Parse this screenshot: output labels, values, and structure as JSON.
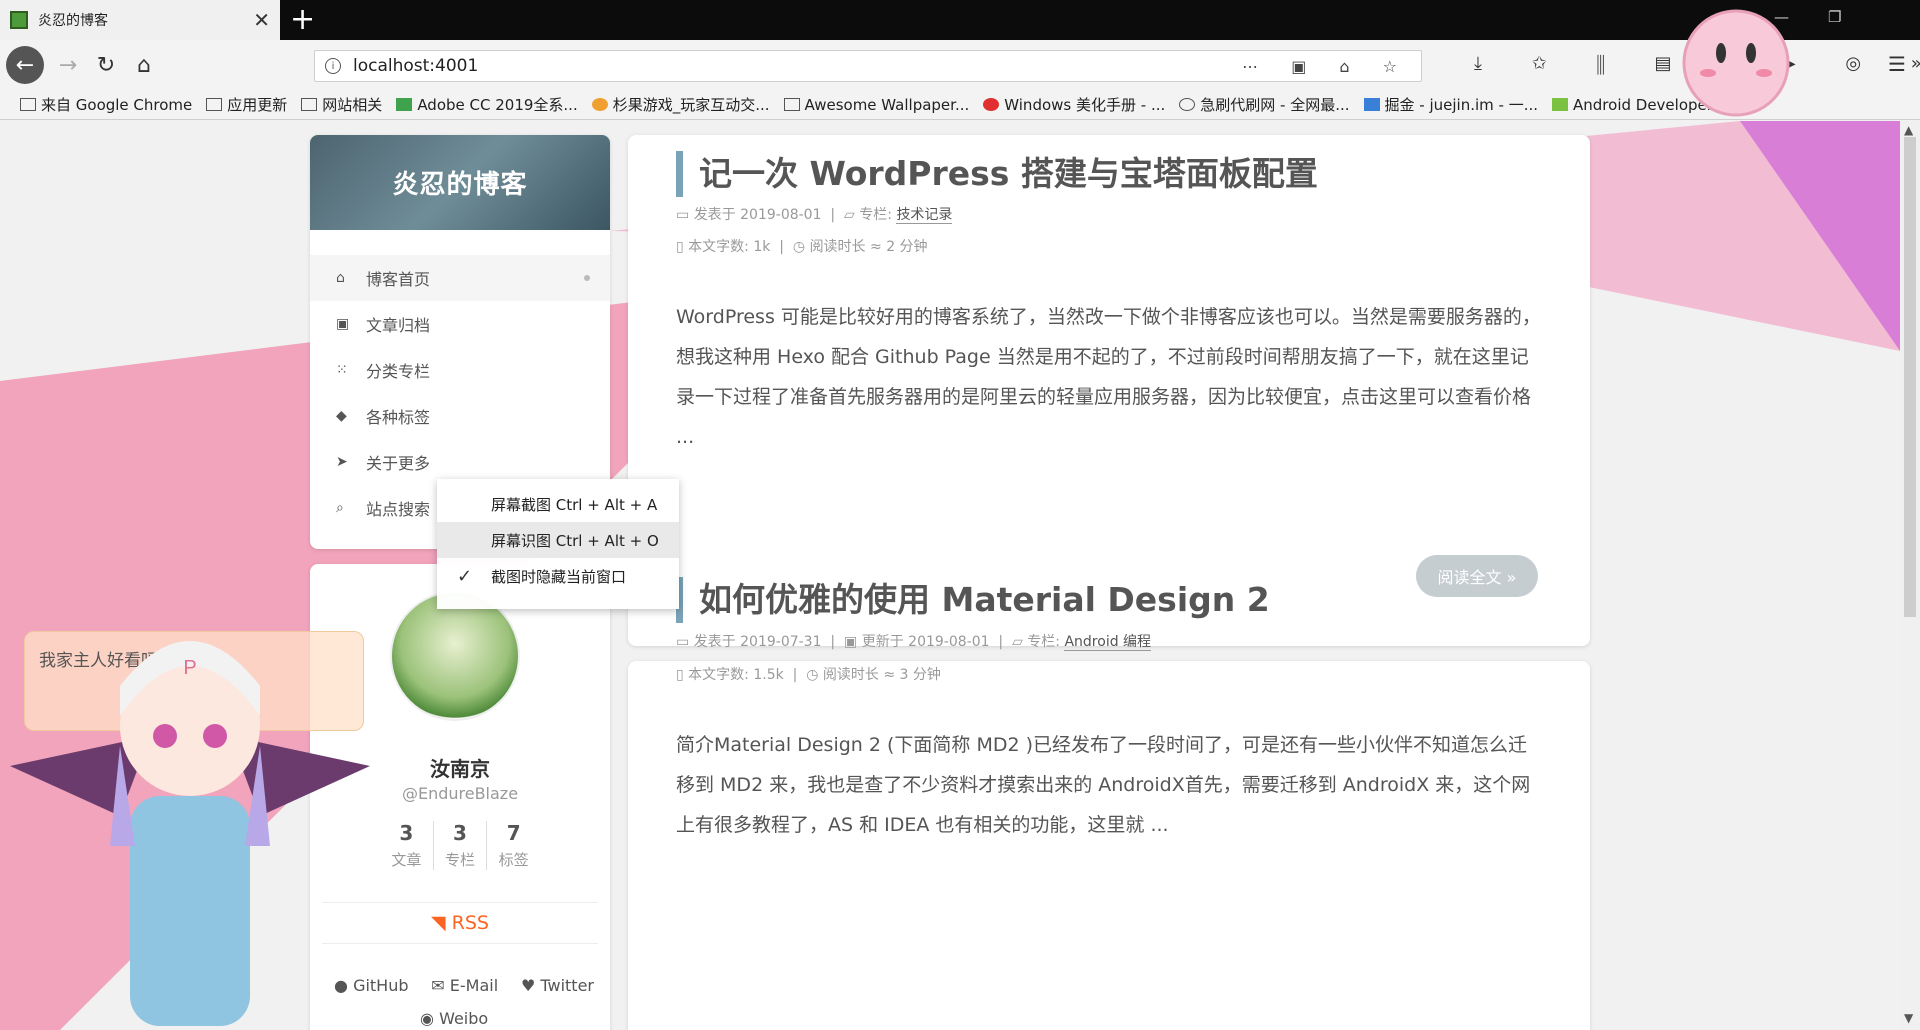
{
  "browser": {
    "tab_title": "炎忍的博客",
    "url": "localhost:4001",
    "bookmarks": [
      "来自 Google Chrome",
      "应用更新",
      "网站相关",
      "Adobe CC 2019全系...",
      "杉果游戏_玩家互动交...",
      "Awesome Wallpaper...",
      "Windows 美化手册 - ...",
      "急刷代刷网 - 全网最...",
      "掘金 - juejin.im - 一...",
      "Android Developers"
    ]
  },
  "sidebar": {
    "brand": "炎忍的博客",
    "menu": [
      {
        "icon": "home-icon",
        "glyph": "⌂",
        "label": "博客首页"
      },
      {
        "icon": "archive-icon",
        "glyph": "▣",
        "label": "文章归档"
      },
      {
        "icon": "grid-icon",
        "glyph": "⁙",
        "label": "分类专栏"
      },
      {
        "icon": "tags-icon",
        "glyph": "◆",
        "label": "各种标签"
      },
      {
        "icon": "location-arrow-icon",
        "glyph": "➤",
        "label": "关于更多"
      },
      {
        "icon": "search-icon",
        "glyph": "⌕",
        "label": "站点搜索"
      }
    ],
    "author": {
      "name": "汝南京",
      "handle": "@EndureBlaze",
      "stats": [
        {
          "num": "3",
          "label": "文章"
        },
        {
          "num": "3",
          "label": "专栏"
        },
        {
          "num": "7",
          "label": "标签"
        }
      ],
      "rss": "RSS",
      "social": [
        "GitHub",
        "E-Mail",
        "Twitter"
      ],
      "social_more": "Weibo"
    }
  },
  "posts": [
    {
      "title": "记一次 WordPress 搭建与宝塔面板配置",
      "published": "发表于 2019-08-01",
      "category_label": "专栏:",
      "category": "技术记录",
      "words": "本文字数: 1k",
      "reading": "阅读时长 ≈ 2 分钟",
      "excerpt": "WordPress 可能是比较好用的博客系统了，当然改一下做个非博客应该也可以。当然是需要服务器的，想我这种用 Hexo 配合 Github Page 当然是用不起的了，不过前段时间帮朋友搞了一下，就在这里记录一下过程了准备首先服务器用的是阿里云的轻量应用服务器，因为比较便宜，点击这里可以查看价格 ...",
      "read_more": "阅读全文 »"
    },
    {
      "title": "如何优雅的使用 Material Design 2",
      "published": "发表于 2019-07-31",
      "updated": "更新于 2019-08-01",
      "category_label": "专栏:",
      "category": "Android 编程",
      "words": "本文字数: 1.5k",
      "reading": "阅读时长 ≈ 3 分钟",
      "excerpt": "简介Material Design 2 (下面简称 MD2 )已经发布了一段时间了，可是还有一些小伙伴不知道怎么迁移到 MD2 来，我也是查了不少资料才摸索出来的 AndroidX首先，需要迁移到 AndroidX 来，这个网上有很多教程了，AS 和 IDEA 也有相关的功能，这里就 ..."
    }
  ],
  "context_menu": [
    "屏幕截图 Ctrl + Alt + A",
    "屏幕识图 Ctrl + Alt + O",
    "截图时隐藏当前窗口"
  ],
  "mascot_bubble": "我家主人好看吗?",
  "colors": {
    "accent": "#7aa3b8",
    "rss": "#fc6423",
    "ribbon_pink": "#f08aa8",
    "ribbon_magenta": "#d56ad1"
  }
}
